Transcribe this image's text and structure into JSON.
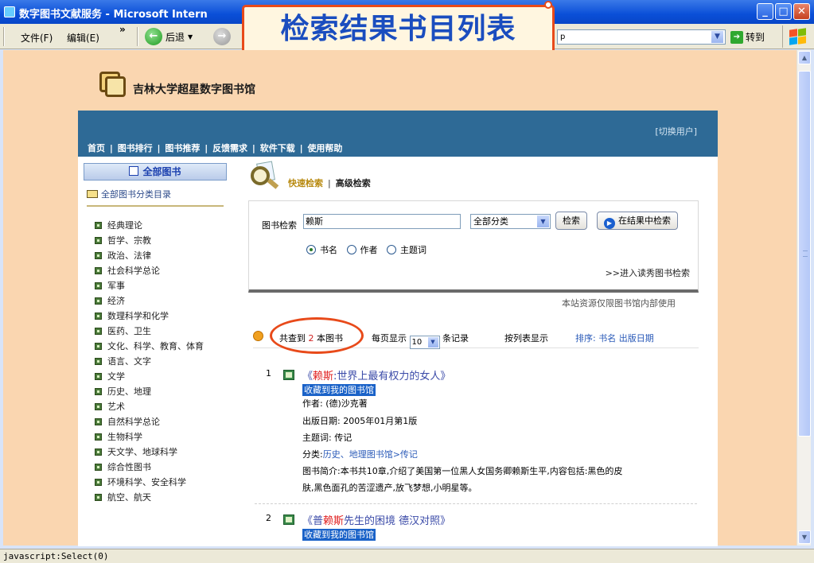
{
  "window": {
    "title": "数字图书文献服务 - Microsoft Intern"
  },
  "toolbar": {
    "file_menu": "文件(F)",
    "edit_menu": "编辑(E)",
    "chevron": "»",
    "back_label": "后退",
    "address_text": "p",
    "go_label": "转到"
  },
  "callout": {
    "text": "检索结果书目列表"
  },
  "site": {
    "logo_text": "吉林大学超星数字图书馆",
    "switch_user": "[切换用户]",
    "nav": [
      "首页",
      "图书排行",
      "图书推荐",
      "反馈需求",
      "软件下载",
      "使用帮助"
    ]
  },
  "sidebar": {
    "tab": "全部图书",
    "heading": "全部图书分类目录",
    "items": [
      "经典理论",
      "哲学、宗教",
      "政治、法律",
      "社会科学总论",
      "军事",
      "经济",
      "数理科学和化学",
      "医药、卫生",
      "文化、科学、教育、体育",
      "语言、文字",
      "文学",
      "历史、地理",
      "艺术",
      "自然科学总论",
      "生物科学",
      "天文学、地球科学",
      "综合性图书",
      "环境科学、安全科学",
      "航空、航天"
    ]
  },
  "search": {
    "quick_tab": "快速检索",
    "separator": "|",
    "adv_tab": "高级检索",
    "label": "图书检索",
    "query": "赖斯",
    "category": "全部分类",
    "search_button": "检索",
    "within_button": "在结果中检索",
    "radio_title": "书名",
    "radio_author": "作者",
    "radio_subject": "主题词",
    "adv_link": ">>进入读秀图书检索",
    "note": "本站资源仅限图书馆内部使用"
  },
  "results": {
    "found_prefix": "共查到",
    "found_count": "2",
    "found_suffix": "本图书",
    "per_page_label": "每页显示",
    "per_page_value": "10",
    "per_page_suffix": "条记录",
    "list_view": "按列表显示",
    "sort": "排序: 书名 出版日期",
    "records": [
      {
        "index": "1",
        "title_pre": "《",
        "title_hl": "赖斯",
        "title_post": ":世界上最有权力的女人》",
        "fav": "收藏到我的图书馆",
        "author": "作者: (德)沙克著",
        "date": "出版日期: 2005年01月第1版",
        "subject": "主题词: 传记",
        "category_label": "分类:",
        "category_link": "历史、地理图书馆>传记",
        "summary_1": "图书简介:本书共10章,介绍了美国第一位黑人女国务卿赖斯生平,内容包括:黑色的皮",
        "summary_2": "肤,黑色面孔的苦涩遗产,放飞梦想,小明星等。"
      },
      {
        "index": "2",
        "title_pre": "《普",
        "title_hl": "赖斯",
        "title_post": "先生的困境 德汉对照》",
        "fav": "收藏到我的图书馆"
      }
    ]
  },
  "status": {
    "text": "javascript:Select(0)"
  }
}
